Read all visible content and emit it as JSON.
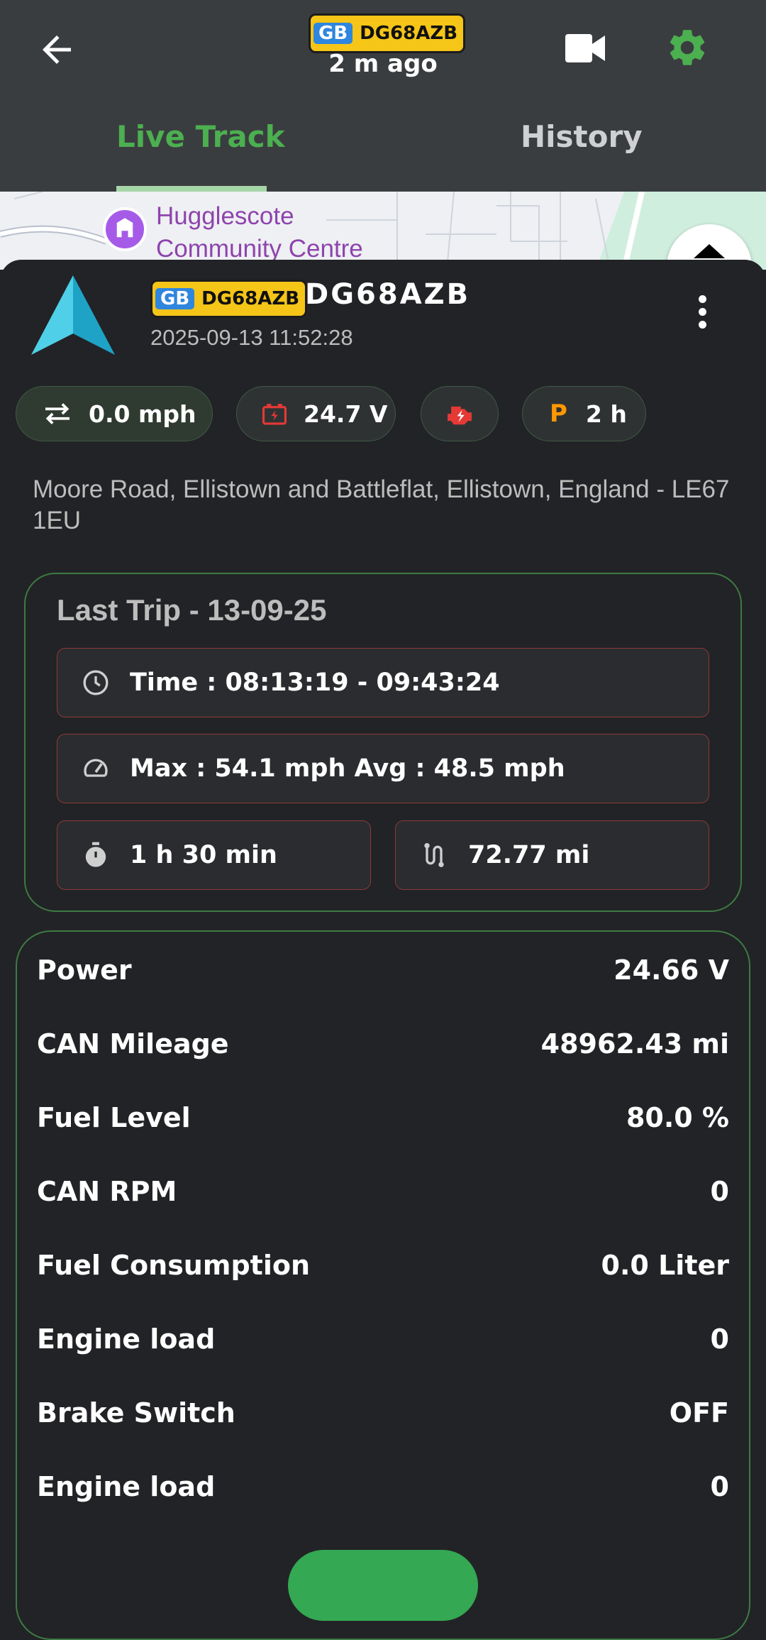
{
  "header": {
    "plate_country": "GB",
    "plate_number": "DG68AZB",
    "last_update": "2 m ago"
  },
  "tabs": [
    {
      "label": "Live Track",
      "active": true
    },
    {
      "label": "History",
      "active": false
    }
  ],
  "map": {
    "poi_name_line1": "Hugglescote",
    "poi_name_line2": "Community Centre"
  },
  "vehicle": {
    "plate_country": "GB",
    "plate_number": "DG68AZB",
    "name": "DG68AZB",
    "timestamp": "2025-09-13 11:52:28",
    "address": "Moore Road, Ellistown and Battleflat, Ellistown, England - LE67 1EU"
  },
  "chips": {
    "speed": "0.0 mph",
    "voltage": "24.7 V",
    "parking_letter": "P",
    "parking_duration": "2 h"
  },
  "last_trip": {
    "title": "Last Trip -  13-09-25",
    "time": "Time : 08:13:19 - 09:43:24",
    "speed": "Max : 54.1 mph  Avg : 48.5 mph",
    "duration": "1 h 30 min",
    "distance": "72.77 mi"
  },
  "details": [
    {
      "label": "Power",
      "value": "24.66 V"
    },
    {
      "label": "CAN Mileage",
      "value": "48962.43 mi"
    },
    {
      "label": "Fuel Level",
      "value": "80.0 %"
    },
    {
      "label": "CAN RPM",
      "value": "0"
    },
    {
      "label": "Fuel Consumption",
      "value": "0.0 Liter"
    },
    {
      "label": "Engine load",
      "value": "0"
    },
    {
      "label": "Brake Switch",
      "value": "OFF"
    },
    {
      "label": "Engine load",
      "value": "0"
    }
  ],
  "colors": {
    "accent_green": "#4caf50",
    "header_bg": "#3a3d40",
    "sheet_bg": "#222326",
    "plate_yellow": "#f5c518",
    "alert_red": "#e53935",
    "parking_orange": "#ff9800"
  },
  "icons": [
    "back-arrow-icon",
    "video-camera-icon",
    "gear-icon",
    "navigation-arrow-icon",
    "more-vert-icon",
    "swap-arrows-icon",
    "battery-icon",
    "engine-icon",
    "clock-icon",
    "speedometer-icon",
    "stopwatch-icon",
    "route-icon"
  ]
}
